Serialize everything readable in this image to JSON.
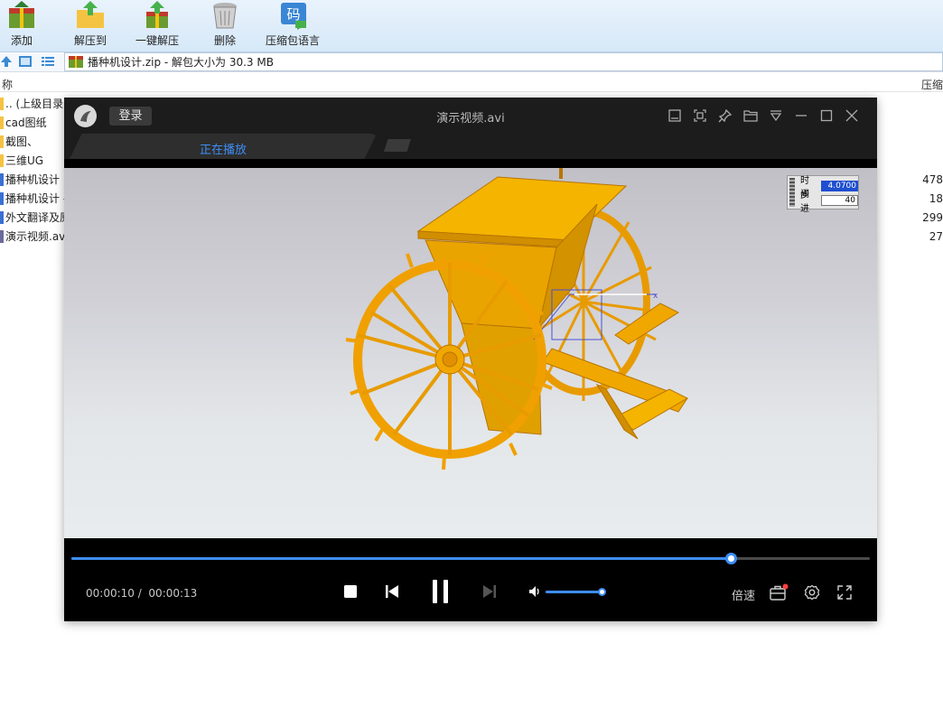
{
  "toolbar": {
    "buttons": [
      {
        "label": "添加",
        "icon": "add-archive-icon"
      },
      {
        "label": "解压到",
        "icon": "extract-to-icon"
      },
      {
        "label": "一键解压",
        "icon": "one-click-extract-icon"
      },
      {
        "label": "删除",
        "icon": "delete-bin-icon"
      },
      {
        "label": "压缩包语言",
        "icon": "archive-language-icon"
      }
    ],
    "language_icon_glyph": "码"
  },
  "address": {
    "text": "播种机设计.zip - 解包大小为 30.3 MB"
  },
  "columns": {
    "name": "称",
    "packed": "压缩"
  },
  "files": [
    {
      "name": ".. (上级目录)",
      "size": ""
    },
    {
      "name": "cad图纸",
      "size": ""
    },
    {
      "name": "截图、",
      "size": ""
    },
    {
      "name": "三维UG",
      "size": ""
    },
    {
      "name": "播种机设计",
      "size": "478"
    },
    {
      "name": "播种机设计 -",
      "size": "18"
    },
    {
      "name": "外文翻译及原",
      "size": "299"
    },
    {
      "name": "演示视频.avi",
      "size": "27"
    }
  ],
  "player": {
    "login_label": "登录",
    "title": "演示视频.avi",
    "tab_label": "正在播放",
    "hud": {
      "time_label": "时间",
      "time_value": "4.0700",
      "step_label": "步进",
      "step_value": "40"
    },
    "time_current": "00:00:10",
    "time_separator": "/",
    "time_total": "00:00:13",
    "progress_fraction": 0.826,
    "volume_fraction": 1.0,
    "speed_label": "倍速",
    "accent_color": "#3e8ef7",
    "notification_dot_color": "#ff4040"
  }
}
